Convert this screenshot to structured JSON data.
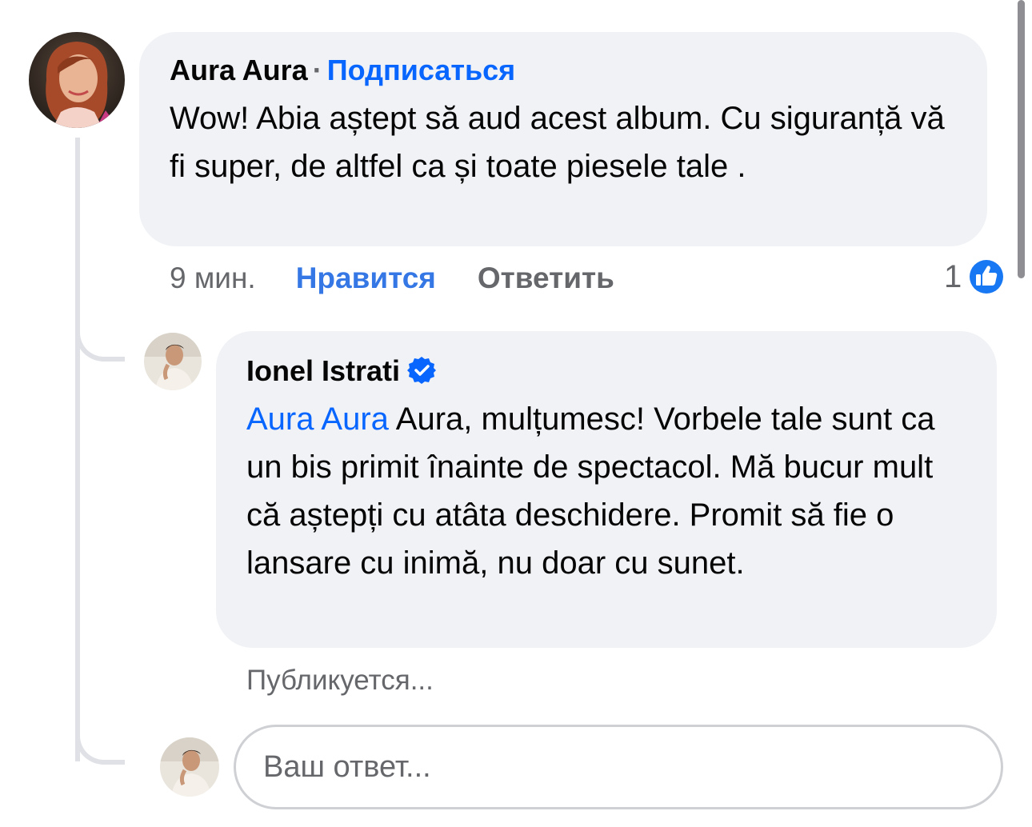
{
  "comment": {
    "author": "Aura Aura",
    "separator": "·",
    "follow_label": "Подписаться",
    "text": "Wow! Abia aștept să aud acest album. Cu siguranță vă fi super, de altfel ca și toate piesele tale .",
    "time": "9 мин.",
    "like_label": "Нравится",
    "reply_label": "Ответить",
    "reaction_count": "1",
    "reaction_icon": "like-thumb-icon"
  },
  "reply": {
    "author": "Ionel Istrati",
    "verified_icon": "verified-badge-icon",
    "mention": "Aura Aura",
    "text": " Aura, mulțumesc! Vorbele tale sunt ca un bis primit înainte de spectacol. Mă bucur mult că aștepți cu atâta deschidere. Promit să fie o lansare cu inimă, nu doar cu sunet.",
    "status": "Публикуется..."
  },
  "composer": {
    "placeholder": "Ваш ответ..."
  },
  "colors": {
    "link_blue": "#0866ff",
    "like_blue": "#3578e5",
    "bubble_bg": "#f0f2f5",
    "secondary_text": "#65676b"
  }
}
